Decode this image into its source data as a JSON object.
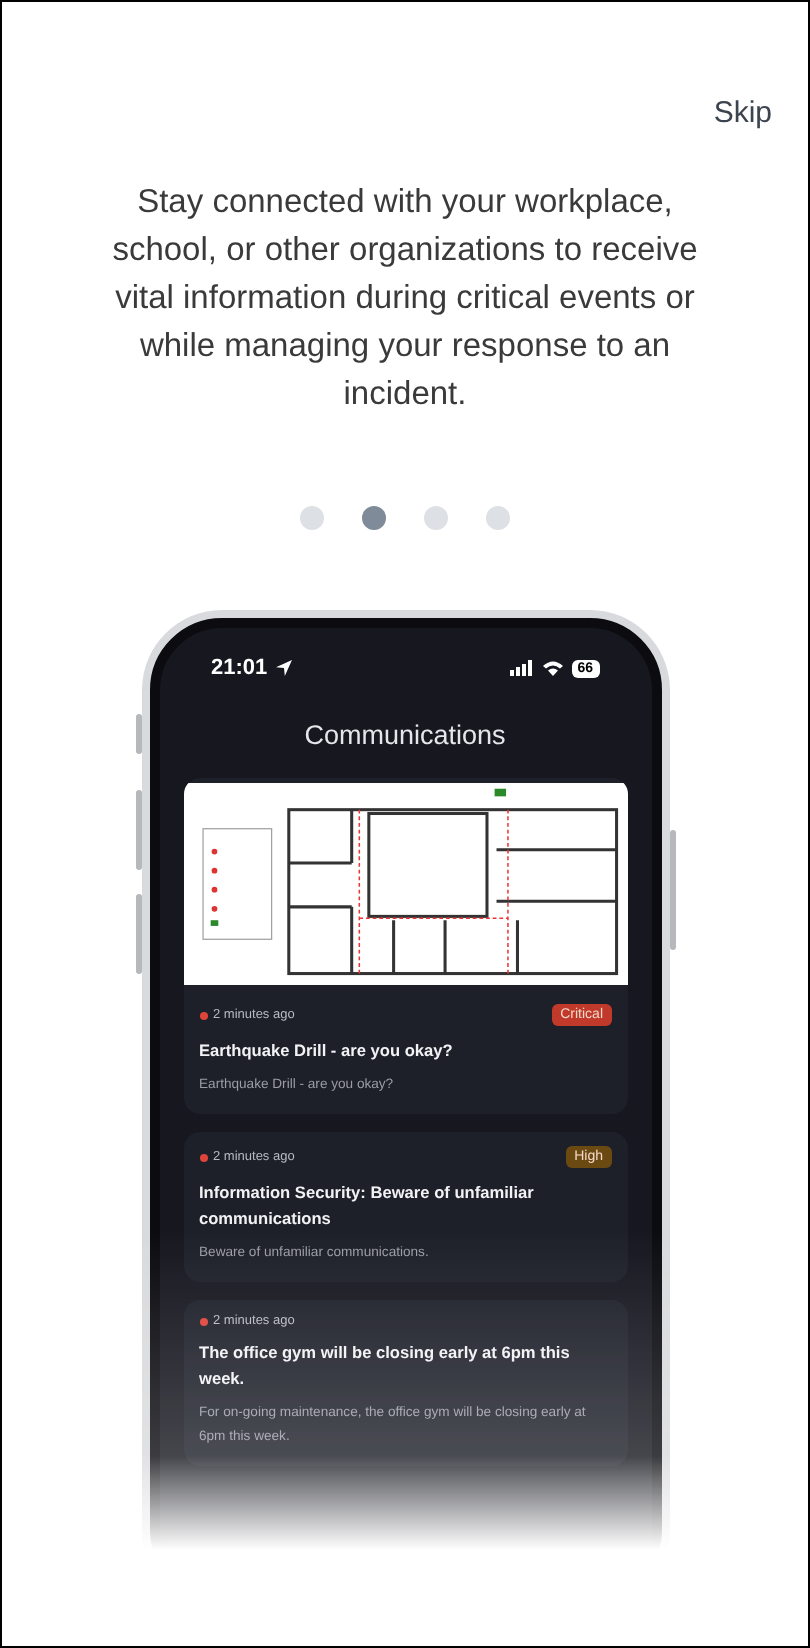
{
  "skip": "Skip",
  "message": "Stay connected with your workplace, school, or other organizations to receive vital information during critical events or while managing your response to an incident.",
  "pager": [
    {
      "selected": false
    },
    {
      "selected": true
    },
    {
      "selected": false
    },
    {
      "selected": false
    }
  ],
  "phone": {
    "status_bar": {
      "time": "21:01",
      "battery": "66"
    },
    "title": "Communications",
    "messages": [
      {
        "time": "2 minutes ago",
        "badge": {
          "label": "Critical",
          "color": "#c0392b"
        },
        "title": "Earthquake Drill - are you okay?",
        "body": "Earthquake Drill - are you okay?",
        "has_map": true
      },
      {
        "time": "2 minutes ago",
        "badge": {
          "label": "High",
          "color": "#6b4a12"
        },
        "title": "Information Security: Beware of unfamiliar communications",
        "body": "Beware of unfamiliar communications.",
        "has_map": false
      },
      {
        "time": "2 minutes ago",
        "title": "The office gym will be closing early at 6pm this week.",
        "body": "For on-going maintenance, the office gym will be closing early at 6pm this week.",
        "has_map": false
      }
    ]
  }
}
